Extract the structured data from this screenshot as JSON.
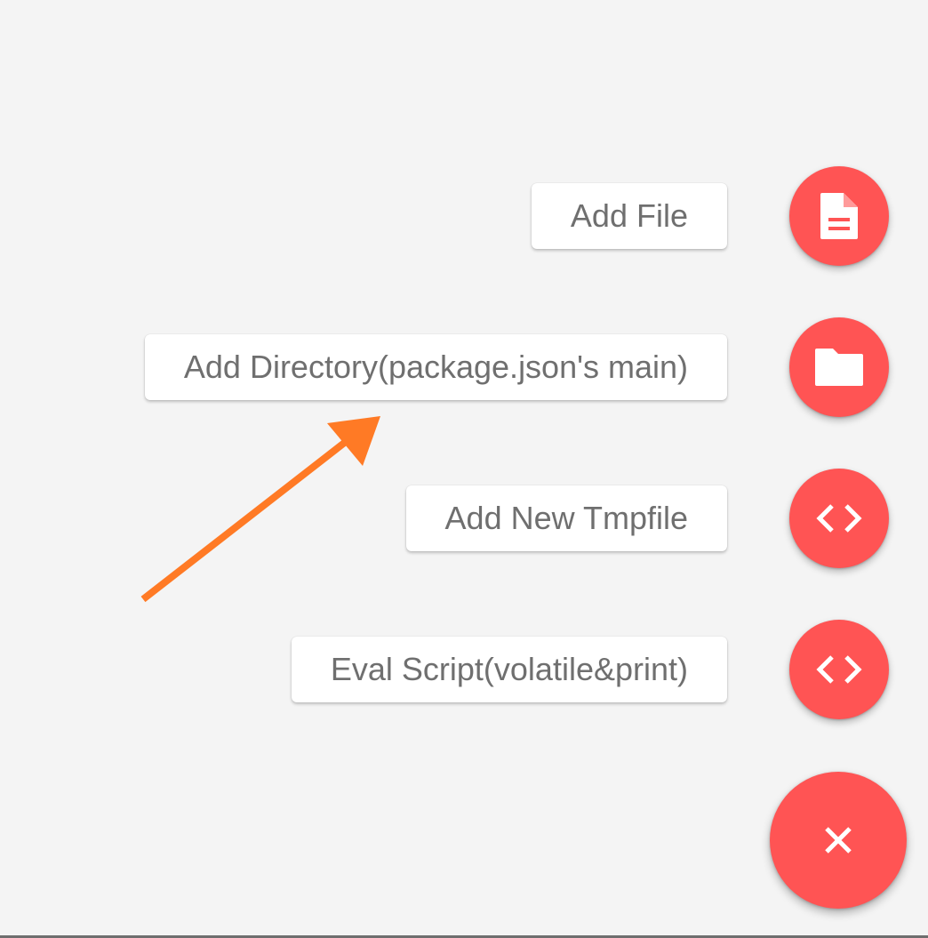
{
  "speed_dial": {
    "items": [
      {
        "label": "Add File",
        "icon": "file-icon"
      },
      {
        "label": "Add Directory(package.json's main)",
        "icon": "folder-icon"
      },
      {
        "label": "Add New Tmpfile",
        "icon": "code-icon"
      },
      {
        "label": "Eval Script(volatile&print)",
        "icon": "code-icon"
      }
    ],
    "close_icon": "close-icon"
  },
  "colors": {
    "background": "#f4f4f4",
    "fab": "#ff5454",
    "label_text": "#6f6f6f",
    "annotation_arrow": "#ff7a25"
  }
}
